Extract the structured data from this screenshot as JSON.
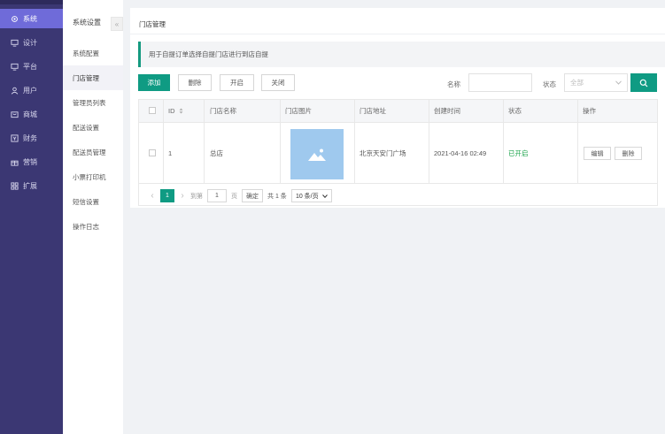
{
  "nav": {
    "items": [
      {
        "label": "系统",
        "icon": "gear-icon",
        "active": true
      },
      {
        "label": "设计",
        "icon": "monitor-icon"
      },
      {
        "label": "平台",
        "icon": "monitor-icon"
      },
      {
        "label": "用户",
        "icon": "user-icon"
      },
      {
        "label": "商城",
        "icon": "shop-icon"
      },
      {
        "label": "财务",
        "icon": "finance-icon"
      },
      {
        "label": "营销",
        "icon": "gift-icon"
      },
      {
        "label": "扩展",
        "icon": "grid-icon"
      }
    ]
  },
  "subnav": {
    "header": "系统设置",
    "collapse_symbol": "«",
    "items": [
      "系统配置",
      "门店管理",
      "管理员列表",
      "配送设置",
      "配送员管理",
      "小票打印机",
      "短信设置",
      "操作日志"
    ],
    "active_index": 1
  },
  "panel": {
    "title": "门店管理",
    "tip": "用于自提订单选择自提门店进行到店自提"
  },
  "toolbar": {
    "add": "添加",
    "delete": "删除",
    "enable": "开启",
    "disable": "关闭",
    "name_label": "名称",
    "name_value": "",
    "status_label": "状态",
    "status_value": "全部"
  },
  "table": {
    "headers": {
      "id": "ID",
      "name": "门店名称",
      "image": "门店图片",
      "address": "门店地址",
      "created": "创建时间",
      "status": "状态",
      "actions": "操作"
    },
    "rows": [
      {
        "id": "1",
        "name": "总店",
        "address": "北京天安门广场",
        "created": "2021-04-16 02:49",
        "status": "已开启",
        "edit": "编辑",
        "delete": "删除"
      }
    ]
  },
  "pagination": {
    "prev": "‹",
    "current": "1",
    "next": "›",
    "goto_label": "到第",
    "goto_value": "1",
    "page_unit": "页",
    "confirm": "确定",
    "total": "共 1 条",
    "per_page": "10 条/页"
  },
  "colors": {
    "accent": "#0f9b83",
    "sidebar": "#3b3773",
    "active": "#6f6bd9",
    "status_on": "#1aa34a"
  }
}
